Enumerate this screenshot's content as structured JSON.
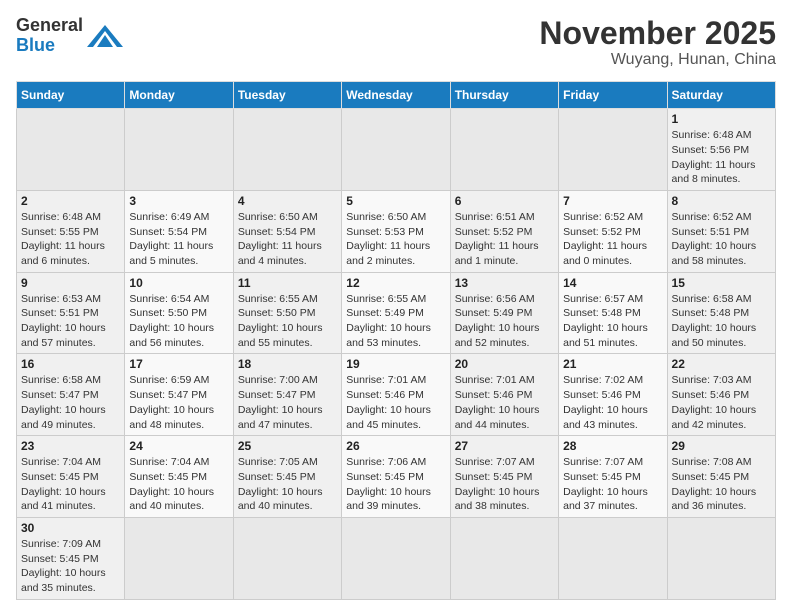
{
  "header": {
    "logo_general": "General",
    "logo_blue": "Blue",
    "month": "November 2025",
    "location": "Wuyang, Hunan, China"
  },
  "weekdays": [
    "Sunday",
    "Monday",
    "Tuesday",
    "Wednesday",
    "Thursday",
    "Friday",
    "Saturday"
  ],
  "weeks": [
    [
      {
        "day": "",
        "info": ""
      },
      {
        "day": "",
        "info": ""
      },
      {
        "day": "",
        "info": ""
      },
      {
        "day": "",
        "info": ""
      },
      {
        "day": "",
        "info": ""
      },
      {
        "day": "",
        "info": ""
      },
      {
        "day": "1",
        "info": "Sunrise: 6:48 AM\nSunset: 5:56 PM\nDaylight: 11 hours\nand 8 minutes."
      }
    ],
    [
      {
        "day": "2",
        "info": "Sunrise: 6:48 AM\nSunset: 5:55 PM\nDaylight: 11 hours\nand 6 minutes."
      },
      {
        "day": "3",
        "info": "Sunrise: 6:49 AM\nSunset: 5:54 PM\nDaylight: 11 hours\nand 5 minutes."
      },
      {
        "day": "4",
        "info": "Sunrise: 6:50 AM\nSunset: 5:54 PM\nDaylight: 11 hours\nand 4 minutes."
      },
      {
        "day": "5",
        "info": "Sunrise: 6:50 AM\nSunset: 5:53 PM\nDaylight: 11 hours\nand 2 minutes."
      },
      {
        "day": "6",
        "info": "Sunrise: 6:51 AM\nSunset: 5:52 PM\nDaylight: 11 hours\nand 1 minute."
      },
      {
        "day": "7",
        "info": "Sunrise: 6:52 AM\nSunset: 5:52 PM\nDaylight: 11 hours\nand 0 minutes."
      },
      {
        "day": "8",
        "info": "Sunrise: 6:52 AM\nSunset: 5:51 PM\nDaylight: 10 hours\nand 58 minutes."
      }
    ],
    [
      {
        "day": "9",
        "info": "Sunrise: 6:53 AM\nSunset: 5:51 PM\nDaylight: 10 hours\nand 57 minutes."
      },
      {
        "day": "10",
        "info": "Sunrise: 6:54 AM\nSunset: 5:50 PM\nDaylight: 10 hours\nand 56 minutes."
      },
      {
        "day": "11",
        "info": "Sunrise: 6:55 AM\nSunset: 5:50 PM\nDaylight: 10 hours\nand 55 minutes."
      },
      {
        "day": "12",
        "info": "Sunrise: 6:55 AM\nSunset: 5:49 PM\nDaylight: 10 hours\nand 53 minutes."
      },
      {
        "day": "13",
        "info": "Sunrise: 6:56 AM\nSunset: 5:49 PM\nDaylight: 10 hours\nand 52 minutes."
      },
      {
        "day": "14",
        "info": "Sunrise: 6:57 AM\nSunset: 5:48 PM\nDaylight: 10 hours\nand 51 minutes."
      },
      {
        "day": "15",
        "info": "Sunrise: 6:58 AM\nSunset: 5:48 PM\nDaylight: 10 hours\nand 50 minutes."
      }
    ],
    [
      {
        "day": "16",
        "info": "Sunrise: 6:58 AM\nSunset: 5:47 PM\nDaylight: 10 hours\nand 49 minutes."
      },
      {
        "day": "17",
        "info": "Sunrise: 6:59 AM\nSunset: 5:47 PM\nDaylight: 10 hours\nand 48 minutes."
      },
      {
        "day": "18",
        "info": "Sunrise: 7:00 AM\nSunset: 5:47 PM\nDaylight: 10 hours\nand 47 minutes."
      },
      {
        "day": "19",
        "info": "Sunrise: 7:01 AM\nSunset: 5:46 PM\nDaylight: 10 hours\nand 45 minutes."
      },
      {
        "day": "20",
        "info": "Sunrise: 7:01 AM\nSunset: 5:46 PM\nDaylight: 10 hours\nand 44 minutes."
      },
      {
        "day": "21",
        "info": "Sunrise: 7:02 AM\nSunset: 5:46 PM\nDaylight: 10 hours\nand 43 minutes."
      },
      {
        "day": "22",
        "info": "Sunrise: 7:03 AM\nSunset: 5:46 PM\nDaylight: 10 hours\nand 42 minutes."
      }
    ],
    [
      {
        "day": "23",
        "info": "Sunrise: 7:04 AM\nSunset: 5:45 PM\nDaylight: 10 hours\nand 41 minutes."
      },
      {
        "day": "24",
        "info": "Sunrise: 7:04 AM\nSunset: 5:45 PM\nDaylight: 10 hours\nand 40 minutes."
      },
      {
        "day": "25",
        "info": "Sunrise: 7:05 AM\nSunset: 5:45 PM\nDaylight: 10 hours\nand 40 minutes."
      },
      {
        "day": "26",
        "info": "Sunrise: 7:06 AM\nSunset: 5:45 PM\nDaylight: 10 hours\nand 39 minutes."
      },
      {
        "day": "27",
        "info": "Sunrise: 7:07 AM\nSunset: 5:45 PM\nDaylight: 10 hours\nand 38 minutes."
      },
      {
        "day": "28",
        "info": "Sunrise: 7:07 AM\nSunset: 5:45 PM\nDaylight: 10 hours\nand 37 minutes."
      },
      {
        "day": "29",
        "info": "Sunrise: 7:08 AM\nSunset: 5:45 PM\nDaylight: 10 hours\nand 36 minutes."
      }
    ],
    [
      {
        "day": "30",
        "info": "Sunrise: 7:09 AM\nSunset: 5:45 PM\nDaylight: 10 hours\nand 35 minutes."
      },
      {
        "day": "",
        "info": ""
      },
      {
        "day": "",
        "info": ""
      },
      {
        "day": "",
        "info": ""
      },
      {
        "day": "",
        "info": ""
      },
      {
        "day": "",
        "info": ""
      },
      {
        "day": "",
        "info": ""
      }
    ]
  ]
}
